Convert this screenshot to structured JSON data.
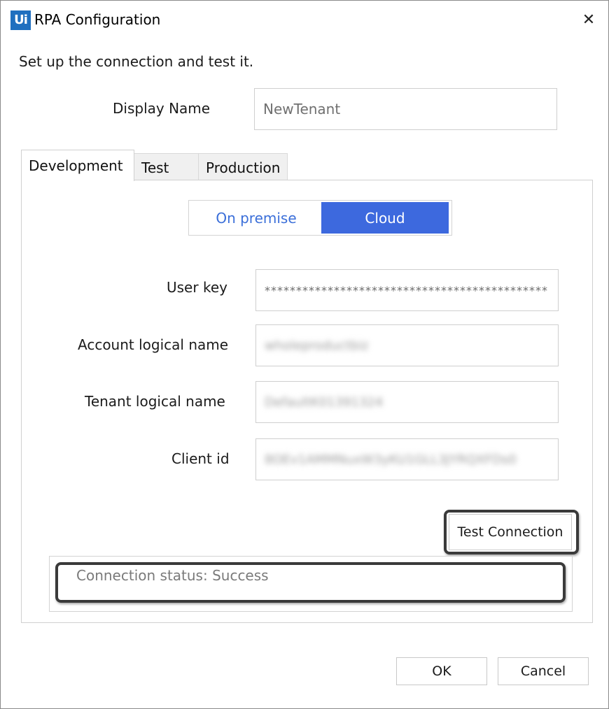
{
  "window": {
    "logo_text": "Ui",
    "title": "RPA Configuration",
    "close_glyph": "✕"
  },
  "intro": "Set up the connection and test it.",
  "display_name": {
    "label": "Display Name",
    "value": "NewTenant"
  },
  "tabs": [
    {
      "label": "Development",
      "active": true
    },
    {
      "label": "Test",
      "active": false
    },
    {
      "label": "Production",
      "active": false
    }
  ],
  "deployment_toggle": {
    "options": [
      "On premise",
      "Cloud"
    ],
    "selected": "Cloud"
  },
  "fields": {
    "user_key": {
      "label": "User key",
      "value": "*********************************************"
    },
    "account_logical_name": {
      "label": "Account logical name",
      "value": "wholeproductbiz"
    },
    "tenant_logical_name": {
      "label": "Tenant logical name",
      "value": "DefaultK01391324"
    },
    "client_id": {
      "label": "Client id",
      "value": "8OEv1AMMNuxW3yKU1GLL3JYRQXFDs0"
    }
  },
  "test_connection_label": "Test Connection",
  "connection_status": "Connection status: Success",
  "footer": {
    "ok_label": "OK",
    "cancel_label": "Cancel"
  },
  "colors": {
    "accent": "#3d69de",
    "accent_text": "#3b6fd9",
    "logo_bg": "#1f6fbf",
    "highlight_border": "#3a3a3a"
  }
}
